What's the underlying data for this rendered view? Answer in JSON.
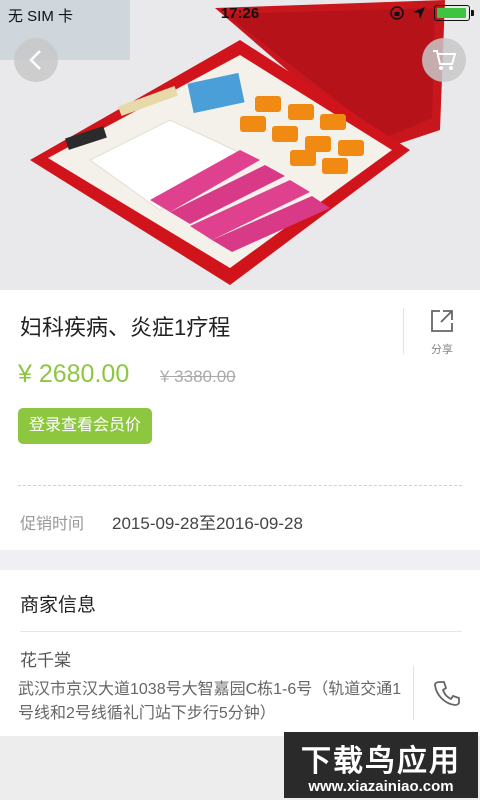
{
  "status_bar": {
    "carrier": "无 SIM 卡",
    "time": "17:26"
  },
  "product": {
    "title": "妇科疾病、炎症1疗程",
    "price": "¥ 2680.00",
    "original_price": "¥ 3380.00",
    "member_button": "登录查看会员价",
    "share_label": "分享",
    "promo_label": "促销时间",
    "promo_value": "2015-09-28至2016-09-28"
  },
  "merchant": {
    "section_title": "商家信息",
    "name": "花千棠",
    "address": "武汉市京汉大道1038号大智嘉园C栋1-6号（轨道交通1号线和2号线循礼门站下步行5分钟）"
  },
  "watermark": {
    "line1": "下载鸟应用",
    "line2": "www.xiazainiao.com"
  },
  "icons": [
    "back-icon",
    "cart-icon",
    "share-icon",
    "phone-icon",
    "wifi-icon",
    "battery-icon",
    "location-icon",
    "lock-rotation-icon"
  ],
  "colors": {
    "accent": "#8dc63f"
  }
}
